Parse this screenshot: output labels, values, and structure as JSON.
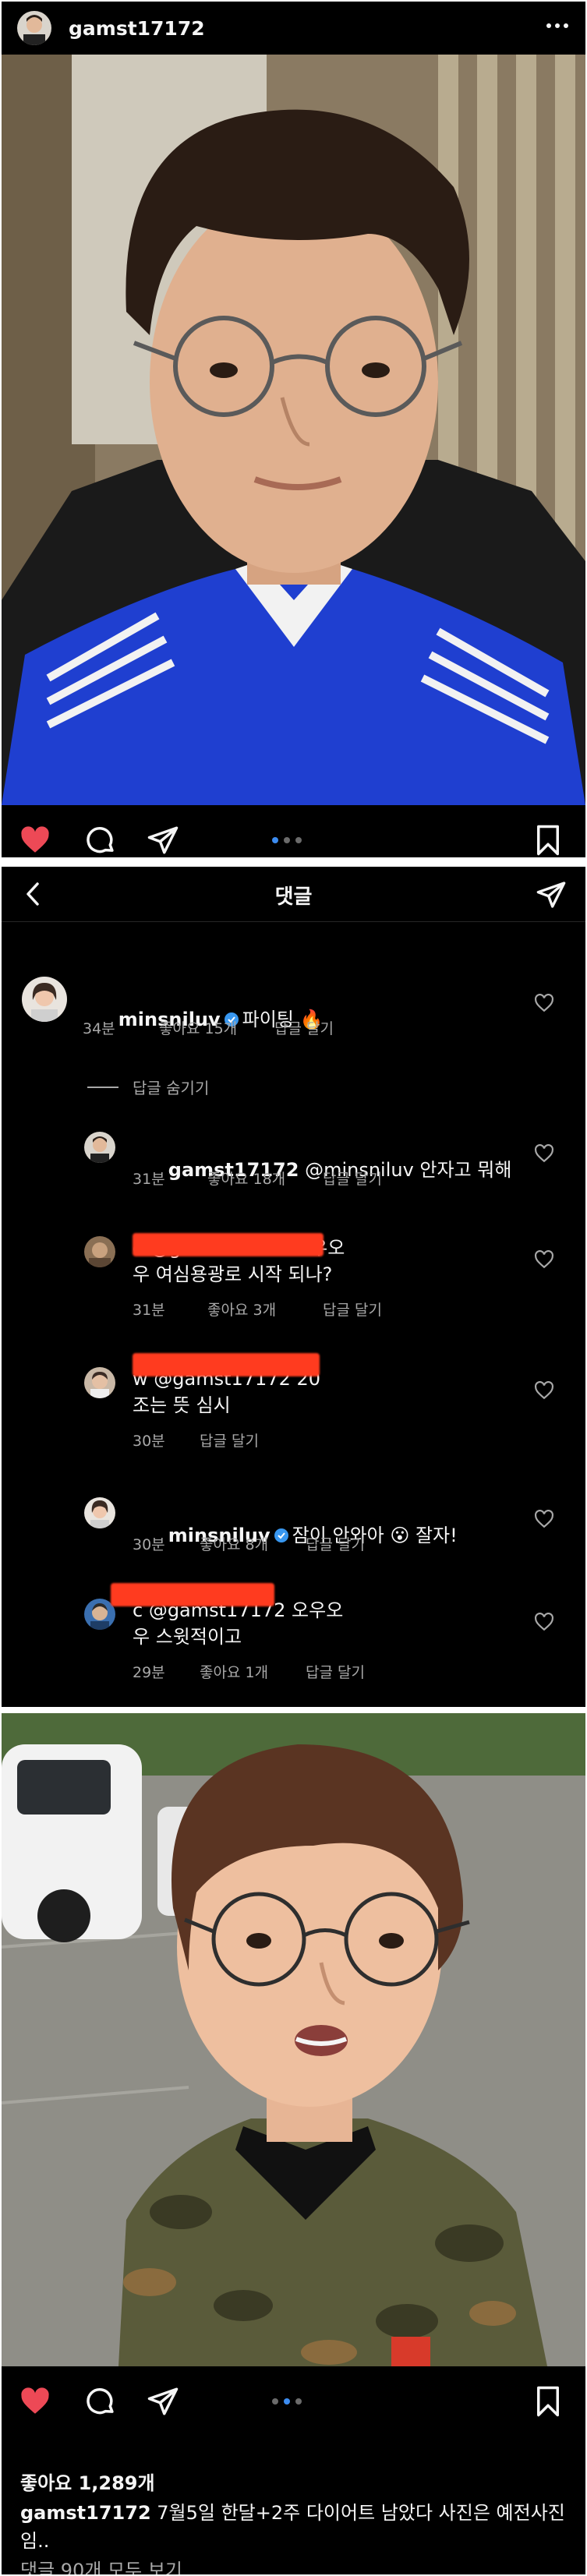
{
  "post1": {
    "username": "gamst17172",
    "colors": {
      "heart": "#ed4956",
      "dot_active": "#3c8cf0",
      "dot_inactive": "#6b6b6b"
    },
    "icons": [
      "heart-icon",
      "comment-icon",
      "share-icon",
      "bookmark-icon",
      "more-icon"
    ]
  },
  "comments_screen": {
    "title": "댓글",
    "icons": [
      "back-chevron-icon",
      "send-icon"
    ],
    "hide_replies": "답글 숨기기",
    "comments": [
      {
        "user": "minsniluv",
        "verified": true,
        "text": "파이팅 🔥",
        "time": "34분",
        "likes": "좋아요 15개",
        "reply": "답글 달기"
      },
      {
        "user": "gamst17172",
        "text": "@minsniluv 안자고 뭐해",
        "time": "31분",
        "likes": "좋아요 18개",
        "reply": "답글 달기"
      },
      {
        "user": "",
        "text": "d @gamst17172 오우오\n우 여심용광로 시작 되나?",
        "time": "31분",
        "likes": "좋아요 3개",
        "reply": "답글 달기"
      },
      {
        "user": "",
        "text": "w @gamst17172 20\n조는 뜻 심시",
        "time": "30분",
        "likes": "",
        "reply": "답글 달기"
      },
      {
        "user": "minsniluv",
        "verified": true,
        "text": "잠이 안와아 😮 잘자!",
        "time": "30분",
        "likes": "좋아요 8개",
        "reply": "답글 달기"
      },
      {
        "user": "",
        "text": "c @gamst17172 오우오\n우 스윗적이고",
        "time": "29분",
        "likes": "좋아요 1개",
        "reply": "답글 달기"
      }
    ]
  },
  "post2": {
    "likes": "좋아요 1,289개",
    "caption_user": "gamst17172",
    "caption_text": " 7월5일 한달+2주 다이어트 남았다 사진은 예전사진임..",
    "view_comments": "댓글 90개 모두 보기",
    "carousel": {
      "count": 3,
      "active": 2
    }
  }
}
